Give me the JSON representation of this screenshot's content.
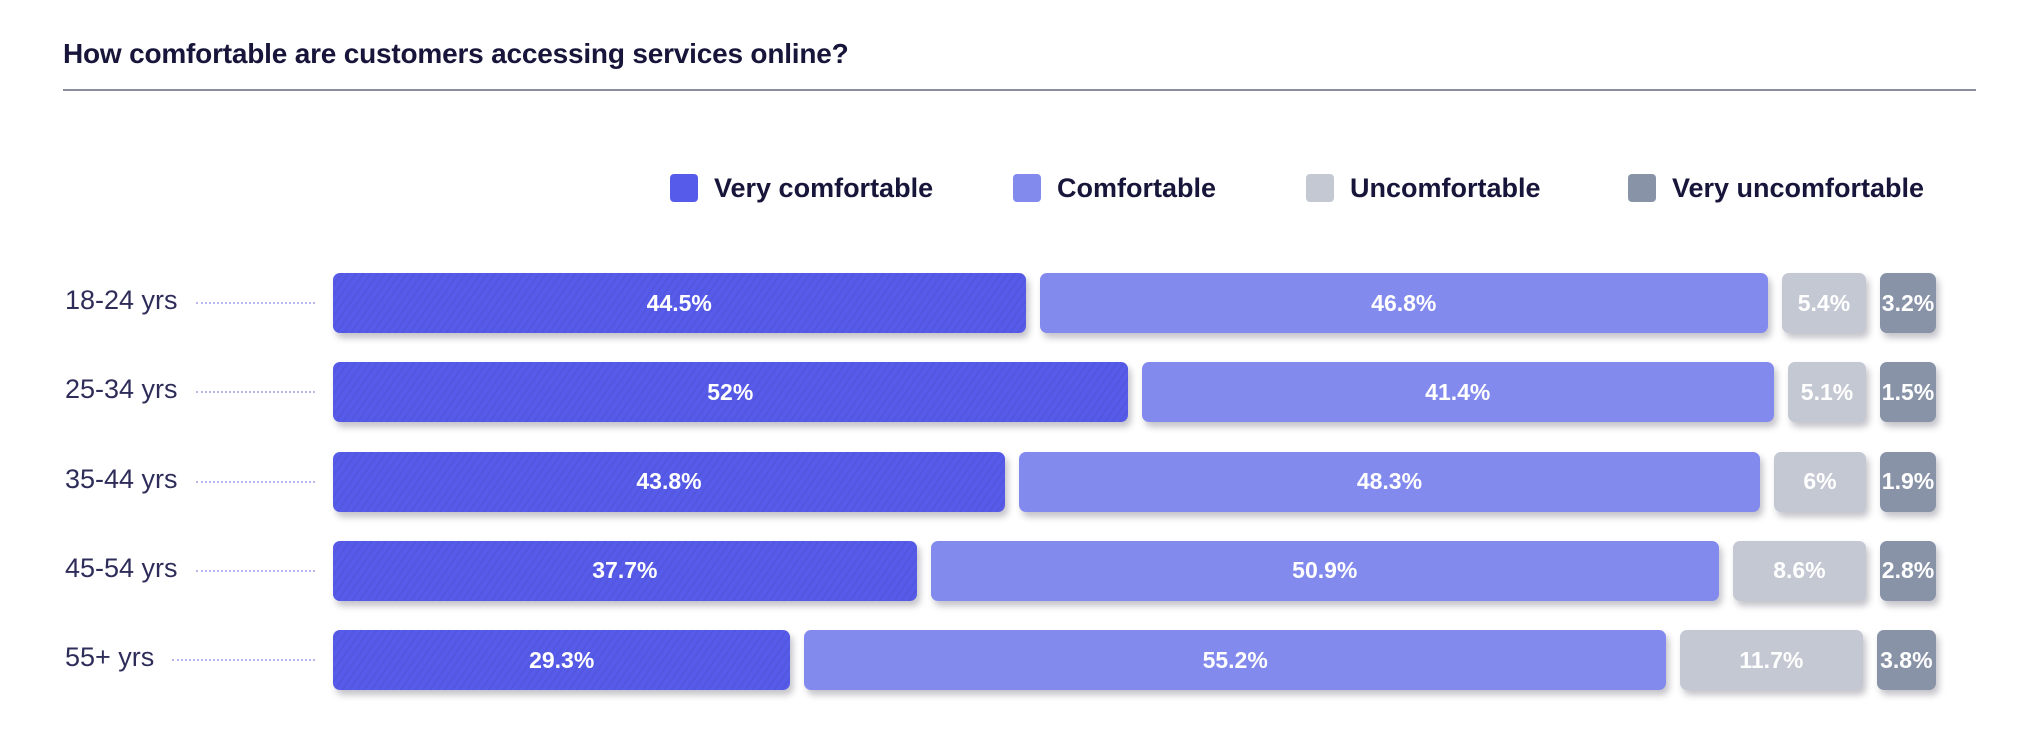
{
  "colors": {
    "very_comfortable": "#575bea",
    "comfortable": "#838aee",
    "uncomfortable": "#c3c8d2",
    "very_uncomfortable": "#8893a8"
  },
  "chart_data": {
    "type": "bar",
    "orientation": "horizontal",
    "stacked": true,
    "title": "How comfortable are customers accessing services online?",
    "xlabel": "",
    "ylabel": "",
    "categories": [
      "18-24 yrs",
      "25-34 yrs",
      "35-44 yrs",
      "45-54 yrs",
      "55+ yrs"
    ],
    "series": [
      {
        "name": "Very comfortable",
        "values": [
          44.5,
          52,
          43.8,
          37.7,
          29.3
        ],
        "labels": [
          "44.5%",
          "52%",
          "43.8%",
          "37.7%",
          "29.3%"
        ]
      },
      {
        "name": "Comfortable",
        "values": [
          46.8,
          41.4,
          48.3,
          50.9,
          55.2
        ],
        "labels": [
          "46.8%",
          "41.4%",
          "48.3%",
          "50.9%",
          "55.2%"
        ]
      },
      {
        "name": "Uncomfortable",
        "values": [
          5.4,
          5.1,
          6,
          8.6,
          11.7
        ],
        "labels": [
          "5.4%",
          "5.1%",
          "6%",
          "8.6%",
          "11.7%"
        ]
      },
      {
        "name": "Very uncomfortable",
        "values": [
          3.2,
          1.5,
          1.9,
          2.8,
          3.8
        ],
        "labels": [
          "3.2%",
          "1.5%",
          "1.9%",
          "2.8%",
          "3.8%"
        ]
      }
    ],
    "unit": "%",
    "legend_position": "top-right",
    "grid": false,
    "xlim": [
      0,
      100
    ]
  }
}
